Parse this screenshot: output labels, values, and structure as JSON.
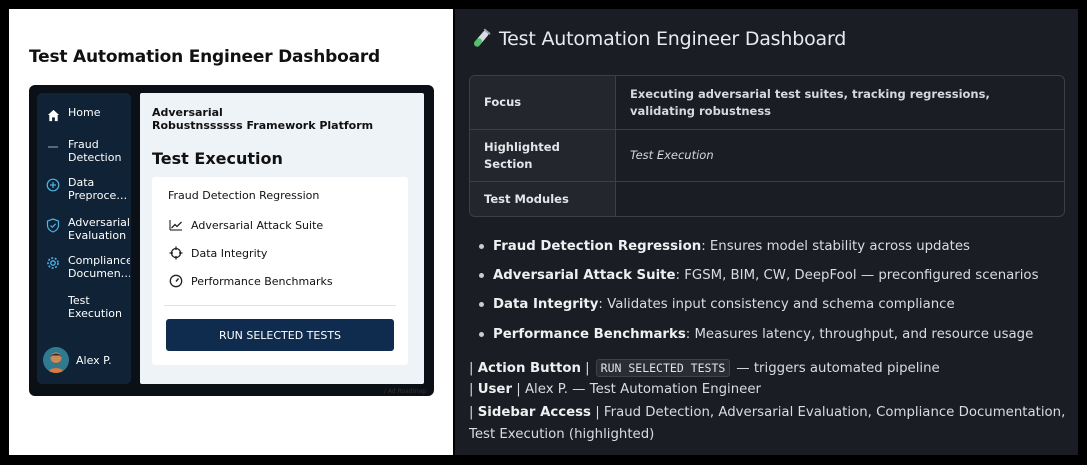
{
  "left_panel": {
    "title": "Test Automation Engineer Dashboard",
    "sidebar": {
      "items": [
        {
          "label": "Home",
          "icon": "home-icon"
        },
        {
          "label": "Fraud\nDetection",
          "icon": "dash-icon"
        },
        {
          "label": "Data\nPreproce…",
          "icon": "plus-circle-icon"
        },
        {
          "label": "Adversarial\nEvaluation",
          "icon": "shield-check-icon"
        },
        {
          "label": "Compliance\nDocumen…",
          "icon": "gear-icon"
        },
        {
          "label": "Test\nExecution",
          "icon": ""
        }
      ],
      "user": "Alex P."
    },
    "app_name": "Adversarial\nRobustnssssss Framework Platform",
    "section_title": "Test Execution",
    "card": {
      "heading": "Fraud Detection Regression",
      "modules": [
        {
          "label": "Adversarial Attack Suite",
          "icon": "trend-icon"
        },
        {
          "label": "Data Integrity",
          "icon": "crosshair-icon"
        },
        {
          "label": "Performance  Benchmarks",
          "icon": "gauge-icon"
        }
      ],
      "button": "RUN SELECTED TESTS"
    },
    "watermark": "/ Ad Roadmap"
  },
  "right_panel": {
    "title_icon": "test-tube-icon",
    "title": "Test Automation Engineer Dashboard",
    "table": [
      {
        "key": "Focus",
        "value": "Executing adversarial test suites, tracking regressions, validating robustness"
      },
      {
        "key": "Highlighted Section",
        "value": "Test Execution"
      },
      {
        "key": "Test Modules",
        "value": ""
      }
    ],
    "bullets": [
      {
        "name": "Fraud Detection Regression",
        "desc": ": Ensures model stability across updates"
      },
      {
        "name": "Adversarial Attack Suite",
        "desc": ": FGSM, BIM, CW, DeepFool — preconfigured scenarios"
      },
      {
        "name": "Data Integrity",
        "desc": ": Validates input consistency and schema compliance"
      },
      {
        "name": "Performance Benchmarks",
        "desc": ": Measures latency, throughput, and resource usage"
      }
    ],
    "meta": {
      "action_label": "Action Button",
      "action_code": "RUN SELECTED TESTS",
      "action_desc": "— triggers automated pipeline",
      "user_label": "User",
      "user_desc": "Alex P. — Test Automation Engineer",
      "sidebar_label": "Sidebar Access",
      "sidebar_desc": "Fraud Detection, Adversarial Evaluation, Compliance Documentation,",
      "sidebar_desc_cont": "Test Execution (highlighted)"
    }
  }
}
